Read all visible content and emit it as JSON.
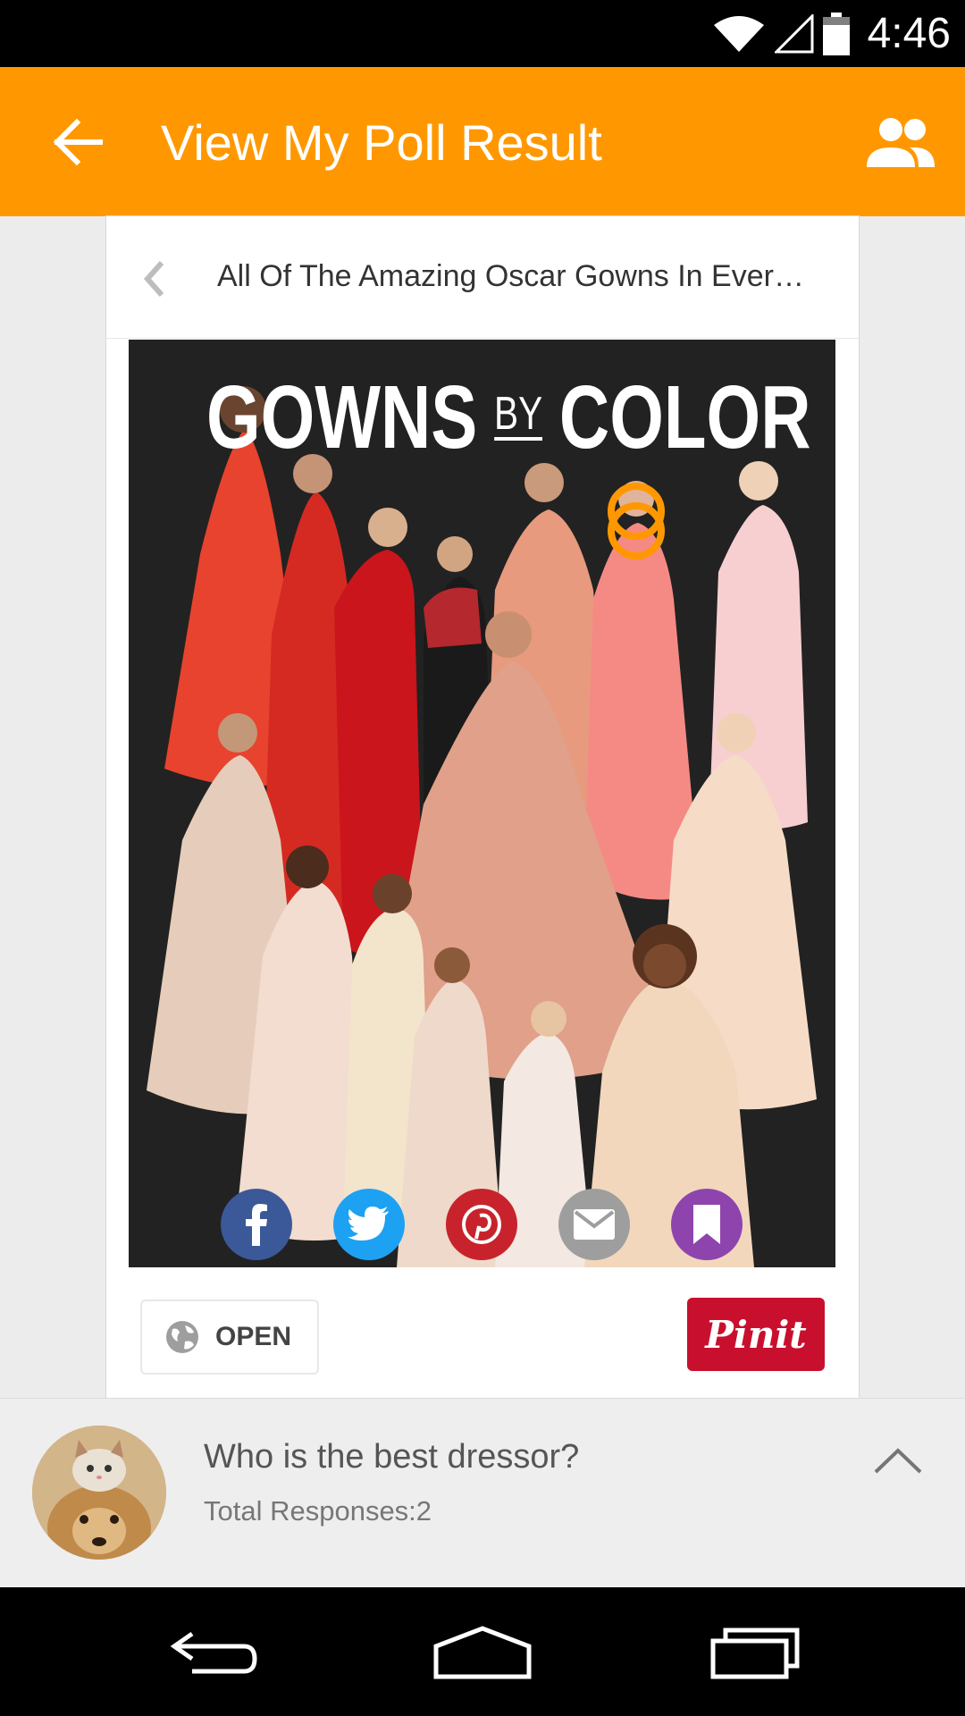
{
  "status_bar": {
    "time": "4:46",
    "icons": [
      "wifi-icon",
      "signal-icon",
      "battery-icon"
    ]
  },
  "app_bar": {
    "title": "View My Poll Result",
    "back_icon": "arrow-back-icon",
    "people_icon": "people-icon",
    "color": "#ff9800"
  },
  "pin_card": {
    "title": "All Of The Amazing Oscar Gowns In Ever…",
    "image_heading": {
      "left": "GOWNS",
      "middle": "BY",
      "right": "COLOR"
    },
    "share_buttons": [
      {
        "name": "facebook",
        "icon": "facebook-icon",
        "color": "#3b5998"
      },
      {
        "name": "twitter",
        "icon": "twitter-icon",
        "color": "#1da1f2"
      },
      {
        "name": "pinterest",
        "icon": "pinterest-icon",
        "color": "#c8232c"
      },
      {
        "name": "email",
        "icon": "mail-icon",
        "color": "#9e9e9e"
      },
      {
        "name": "bookmark",
        "icon": "bookmark-icon",
        "color": "#8e44ad"
      }
    ],
    "open_label": "OPEN",
    "pinit_label": "Pinit",
    "pinit_color": "#c8102e"
  },
  "poll": {
    "question": "Who is the best dressor?",
    "responses": "Total Responses:2"
  },
  "nav_bar": {
    "icons": [
      "back-nav-icon",
      "home-nav-icon",
      "recents-nav-icon"
    ]
  }
}
